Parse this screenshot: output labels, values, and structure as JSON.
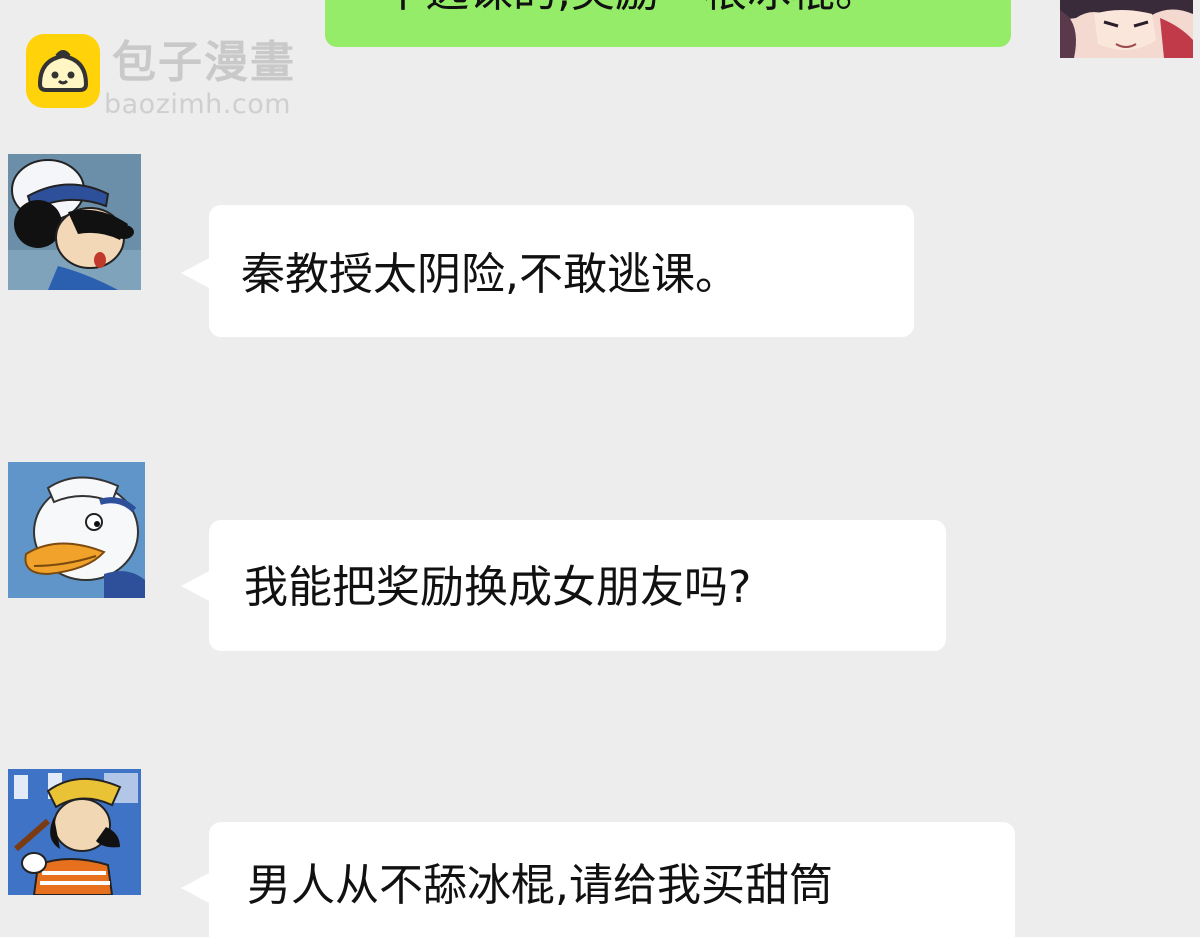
{
  "watermark": {
    "name": "包子漫畫",
    "url": "baozimh.com",
    "logo_icon": "bun-face-icon",
    "logo_color": "#ffd20a"
  },
  "colors": {
    "chat_background": "#ededed",
    "incoming_bubble": "#ffffff",
    "outgoing_bubble": "#95ec69"
  },
  "messages": [
    {
      "side": "right",
      "sender_avatar": "anime-boy-avatar",
      "text": "不逃课的,奖励一根冰棍。"
    },
    {
      "side": "left",
      "sender_avatar": "mickey-mouse-avatar",
      "text": "秦教授太阴险,不敢逃课。"
    },
    {
      "side": "left",
      "sender_avatar": "donald-duck-avatar",
      "text": "我能把奖励换成女朋友吗?"
    },
    {
      "side": "left",
      "sender_avatar": "goofy-avatar",
      "text": "男人从不舔冰棍,请给我买甜筒"
    }
  ]
}
